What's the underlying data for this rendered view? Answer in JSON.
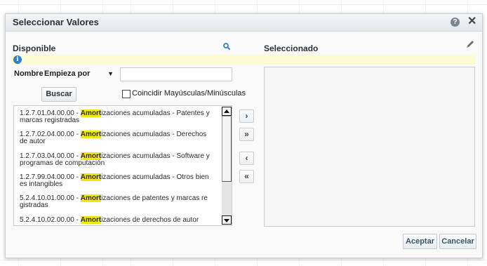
{
  "dialog": {
    "title": "Seleccionar Valores",
    "help_glyph": "?",
    "close_glyph": "✕"
  },
  "available": {
    "label": "Disponible",
    "info_glyph": "i",
    "filter": {
      "label": "Nombre",
      "operator": "Empieza por",
      "value": "",
      "search_button": "Buscar",
      "match_case_label": "Coincidir Mayúsculas/Minúsculas",
      "match_case_checked": false
    },
    "items": [
      {
        "code": "1.2.7.01.04.00.00 - ",
        "highlight": "Amort",
        "rest": "izaciones acumuladas - Patentes y",
        "line2": "marcas registradas"
      },
      {
        "code": "1.2.7.02.04.00.00 - ",
        "highlight": "Amort",
        "rest": "izaciones acumuladas - Derechos",
        "line2": "de autor"
      },
      {
        "code": "1.2.7.03.04.00.00 - ",
        "highlight": "Amort",
        "rest": "izaciones acumuladas - Software y",
        "line2": "programas de computación"
      },
      {
        "code": "1.2.7.99.04.00.00 - ",
        "highlight": "Amort",
        "rest": "izaciones acumuladas - Otros bien",
        "line2": "es intangibles"
      },
      {
        "code": "5.2.4.10.01.00.00 - ",
        "highlight": "Amort",
        "rest": "izaciones de patentes y marcas re",
        "line2": "gistradas"
      },
      {
        "code": "5.2.4.10.02.00.00 - ",
        "highlight": "Amort",
        "rest": "izaciones de derechos de autor",
        "line2": ""
      }
    ]
  },
  "shuttle": {
    "move": "›",
    "move_all": "»",
    "remove": "‹",
    "remove_all": "«"
  },
  "selected": {
    "label": "Seleccionado"
  },
  "footer": {
    "accept": "Aceptar",
    "cancel": "Cancelar"
  },
  "colors": {
    "highlight": "#f2e80c",
    "info_bar": "#fcfbd2",
    "info_icon": "#2f7fcf",
    "button_text": "#38546e"
  },
  "icons": {
    "search": "search-icon",
    "edit": "pencil-icon",
    "help": "help-icon",
    "close": "close-icon",
    "info": "info-icon"
  }
}
